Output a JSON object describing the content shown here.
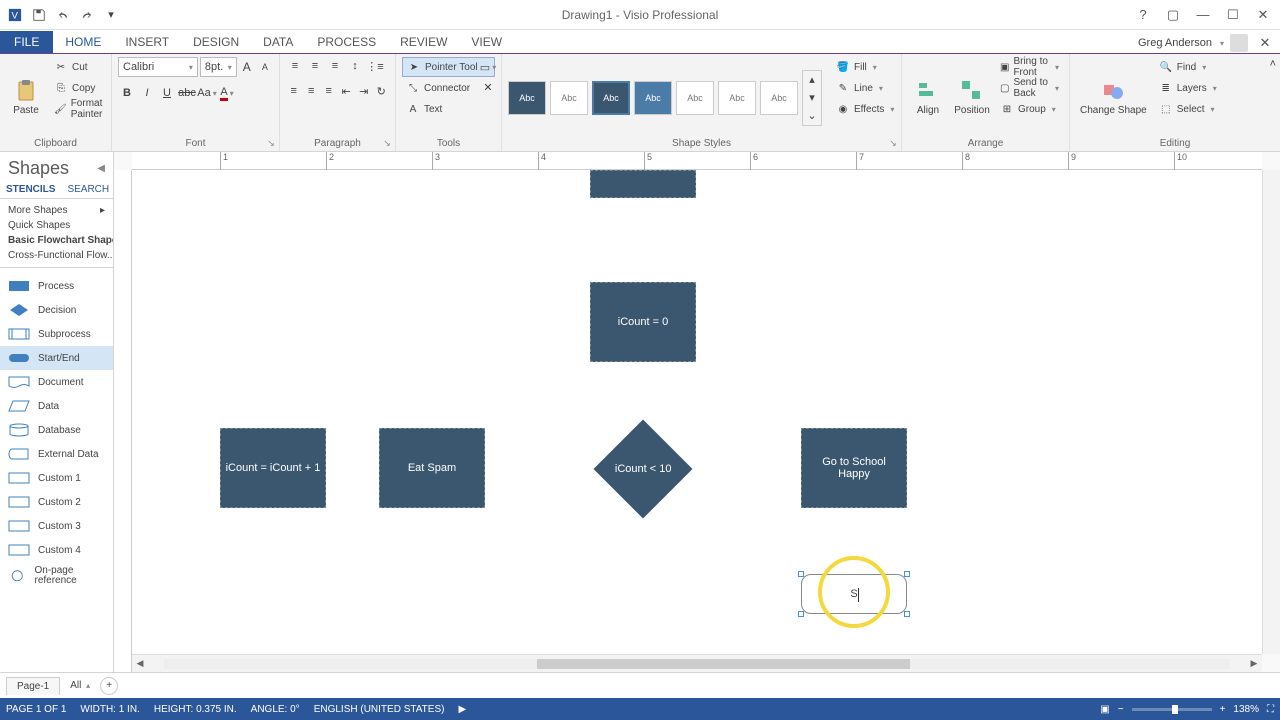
{
  "title_bar": {
    "doc_title": "Drawing1 - Visio Professional"
  },
  "tabs": {
    "file": "FILE",
    "items": [
      "HOME",
      "INSERT",
      "DESIGN",
      "DATA",
      "PROCESS",
      "REVIEW",
      "VIEW"
    ],
    "active": "HOME",
    "user_name": "Greg Anderson"
  },
  "ribbon": {
    "clipboard": {
      "paste": "Paste",
      "cut": "Cut",
      "copy": "Copy",
      "format_painter": "Format Painter",
      "label": "Clipboard"
    },
    "font": {
      "family": "Calibri",
      "size": "8pt.",
      "label": "Font"
    },
    "paragraph": {
      "label": "Paragraph"
    },
    "tools": {
      "pointer": "Pointer Tool",
      "connector": "Connector",
      "text": "Text",
      "label": "Tools"
    },
    "shape_styles": {
      "label": "Shape Styles",
      "fill": "Fill",
      "line": "Line",
      "effects": "Effects",
      "thumb_text": "Abc"
    },
    "arrange": {
      "align": "Align",
      "position": "Position",
      "bring_front": "Bring to Front",
      "send_back": "Send to Back",
      "group": "Group",
      "label": "Arrange"
    },
    "editing": {
      "change_shape": "Change Shape",
      "find": "Find",
      "layers": "Layers",
      "select": "Select",
      "label": "Editing"
    }
  },
  "shapes_panel": {
    "title": "Shapes",
    "tab_stencils": "STENCILS",
    "tab_search": "SEARCH",
    "more_shapes": "More Shapes",
    "quick_shapes": "Quick Shapes",
    "stencils": [
      "Basic Flowchart Shapes",
      "Cross-Functional Flow..."
    ],
    "active_stencil": "Basic Flowchart Shapes",
    "shapes": [
      "Process",
      "Decision",
      "Subprocess",
      "Start/End",
      "Document",
      "Data",
      "Database",
      "External Data",
      "Custom 1",
      "Custom 2",
      "Custom 3",
      "Custom 4",
      "On-page reference"
    ],
    "active_shape": "Start/End"
  },
  "canvas": {
    "ruler_ticks": [
      "1",
      "2",
      "3",
      "4",
      "5",
      "6",
      "7",
      "8",
      "9",
      "10"
    ],
    "shapes": {
      "top_rect": "",
      "icount_init": "iCount = 0",
      "icount_inc": "iCount = iCount + 1",
      "eat_spam": "Eat Spam",
      "decision": "iCount < 10",
      "school": "Go to School Happy",
      "terminator_text": "S"
    }
  },
  "page_tabs": {
    "page1": "Page-1",
    "all": "All"
  },
  "status": {
    "page": "PAGE 1 OF 1",
    "width": "WIDTH: 1 IN.",
    "height": "HEIGHT: 0.375 IN.",
    "angle": "ANGLE: 0°",
    "lang": "ENGLISH (UNITED STATES)",
    "zoom": "138%"
  }
}
